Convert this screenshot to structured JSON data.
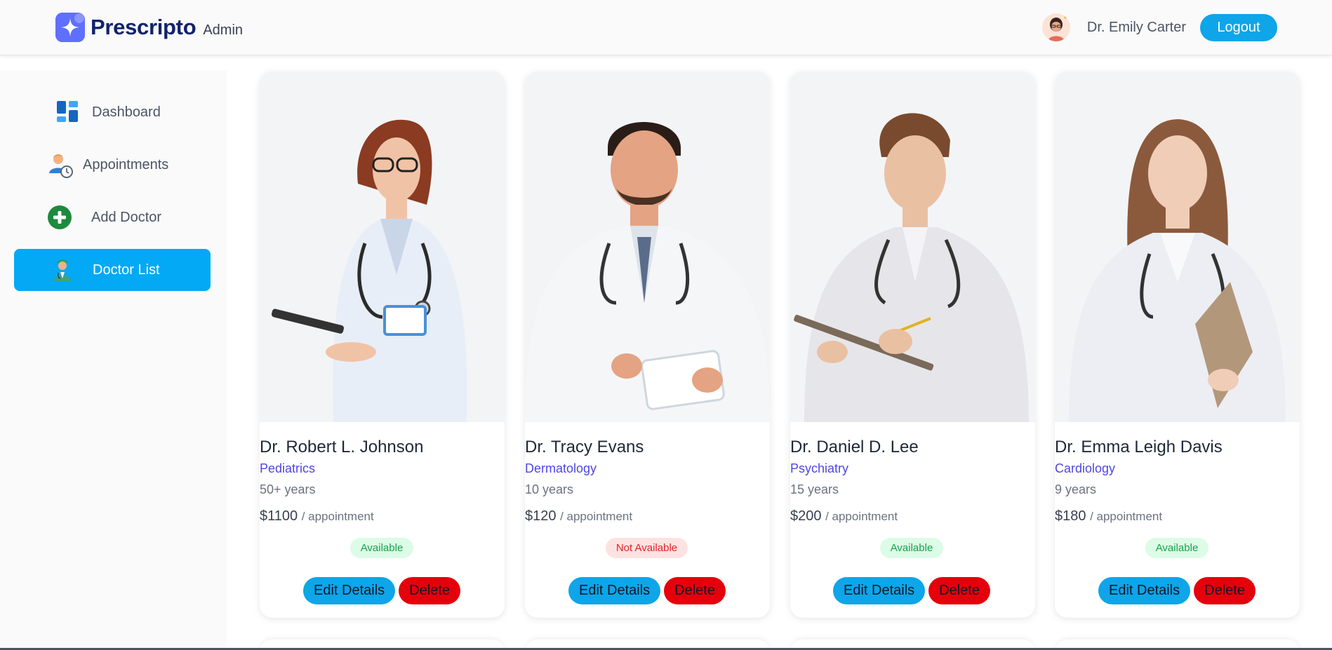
{
  "header": {
    "brand_name": "Prescripto",
    "brand_sub": "Admin",
    "admin_name": "Dr. Emily Carter",
    "logout_label": "Logout"
  },
  "sidebar": {
    "items": [
      {
        "label": "Dashboard",
        "icon": "dashboard-icon",
        "active": false
      },
      {
        "label": "Appointments",
        "icon": "appointments-icon",
        "active": false
      },
      {
        "label": "Add Doctor",
        "icon": "add-circle-icon",
        "active": false
      },
      {
        "label": "Doctor List",
        "icon": "doctor-icon",
        "active": true
      }
    ]
  },
  "doctors": [
    {
      "name": "Dr. Robert L. Johnson",
      "speciality": "Pediatrics",
      "experience": "50+ years",
      "fee": "$1100",
      "fee_suffix": "/ appointment",
      "status": "Available",
      "edit_label": "Edit Details",
      "delete_label": "Delete"
    },
    {
      "name": "Dr. Tracy Evans",
      "speciality": "Dermatology",
      "experience": "10 years",
      "fee": "$120",
      "fee_suffix": "/ appointment",
      "status": "Not Available",
      "edit_label": "Edit Details",
      "delete_label": "Delete"
    },
    {
      "name": "Dr. Daniel D. Lee",
      "speciality": "Psychiatry",
      "experience": "15 years",
      "fee": "$200",
      "fee_suffix": "/ appointment",
      "status": "Available",
      "edit_label": "Edit Details",
      "delete_label": "Delete"
    },
    {
      "name": "Dr. Emma Leigh Davis",
      "speciality": "Cardiology",
      "experience": "9 years",
      "fee": "$180",
      "fee_suffix": "/ appointment",
      "status": "Available",
      "edit_label": "Edit Details",
      "delete_label": "Delete"
    }
  ],
  "colors": {
    "accent": "#03a9f4",
    "brand": "#5f6fff",
    "speciality": "#4f46e5",
    "available": "#16a34a",
    "unavailable": "#dc2626",
    "delete": "#e5000b"
  }
}
